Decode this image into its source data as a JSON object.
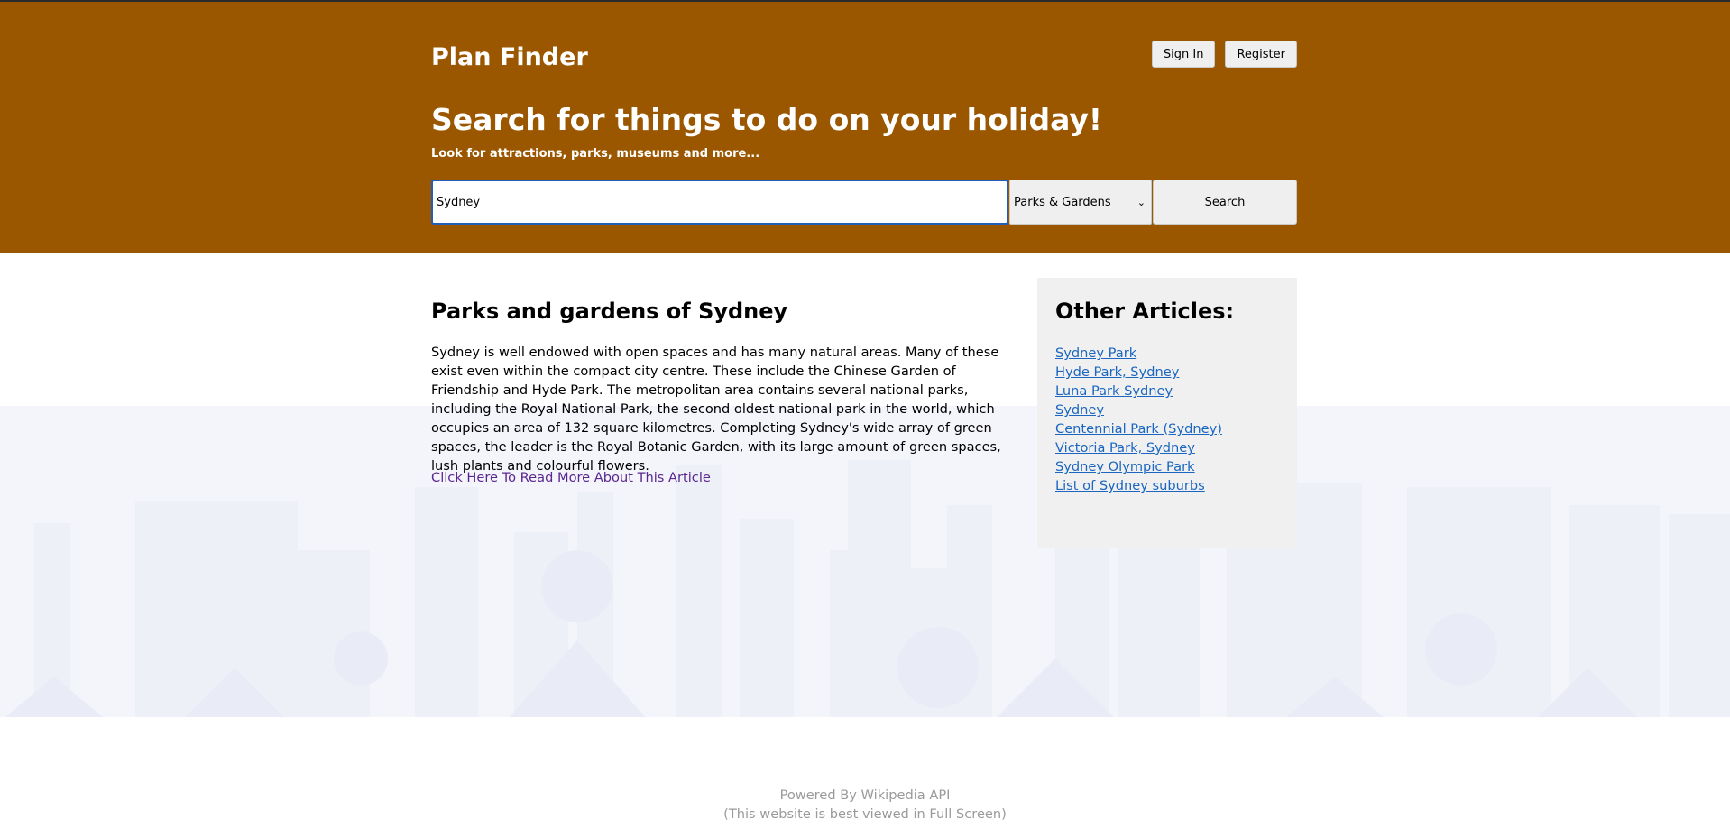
{
  "header": {
    "brand": "Plan Finder",
    "sign_in_label": "Sign In",
    "register_label": "Register",
    "title": "Search for things to do on your holiday!",
    "subtitle": "Look for attractions, parks, museums and more...",
    "background_color": "#9a5700"
  },
  "search": {
    "query": "Sydney",
    "category_selected": "Parks & Gardens",
    "button_label": "Search"
  },
  "article": {
    "title": "Parks and gardens of Sydney",
    "body": "Sydney is well endowed with open spaces and has many natural areas. Many of these exist even within the compact city centre. These include the Chinese Garden of Friendship and Hyde Park. The metropolitan area contains several national parks, including the Royal National Park, the second oldest national park in the world, which occupies an area of 132 square kilometres. Completing Sydney's wide array of green spaces, the leader is the Royal Botanic Garden, with its large amount of green spaces, lush plants and colourful flowers.",
    "read_more_label": "Click Here To Read More About This Article"
  },
  "other_articles": {
    "title": "Other Articles:",
    "items": [
      "Sydney Park",
      "Hyde Park, Sydney",
      "Luna Park Sydney",
      "Sydney",
      "Centennial Park (Sydney)",
      "Victoria Park, Sydney",
      "Sydney Olympic Park",
      "List of Sydney suburbs"
    ]
  },
  "footer": {
    "powered_by": "Powered By Wikipedia API",
    "note": "(This website is best viewed in Full Screen)"
  }
}
